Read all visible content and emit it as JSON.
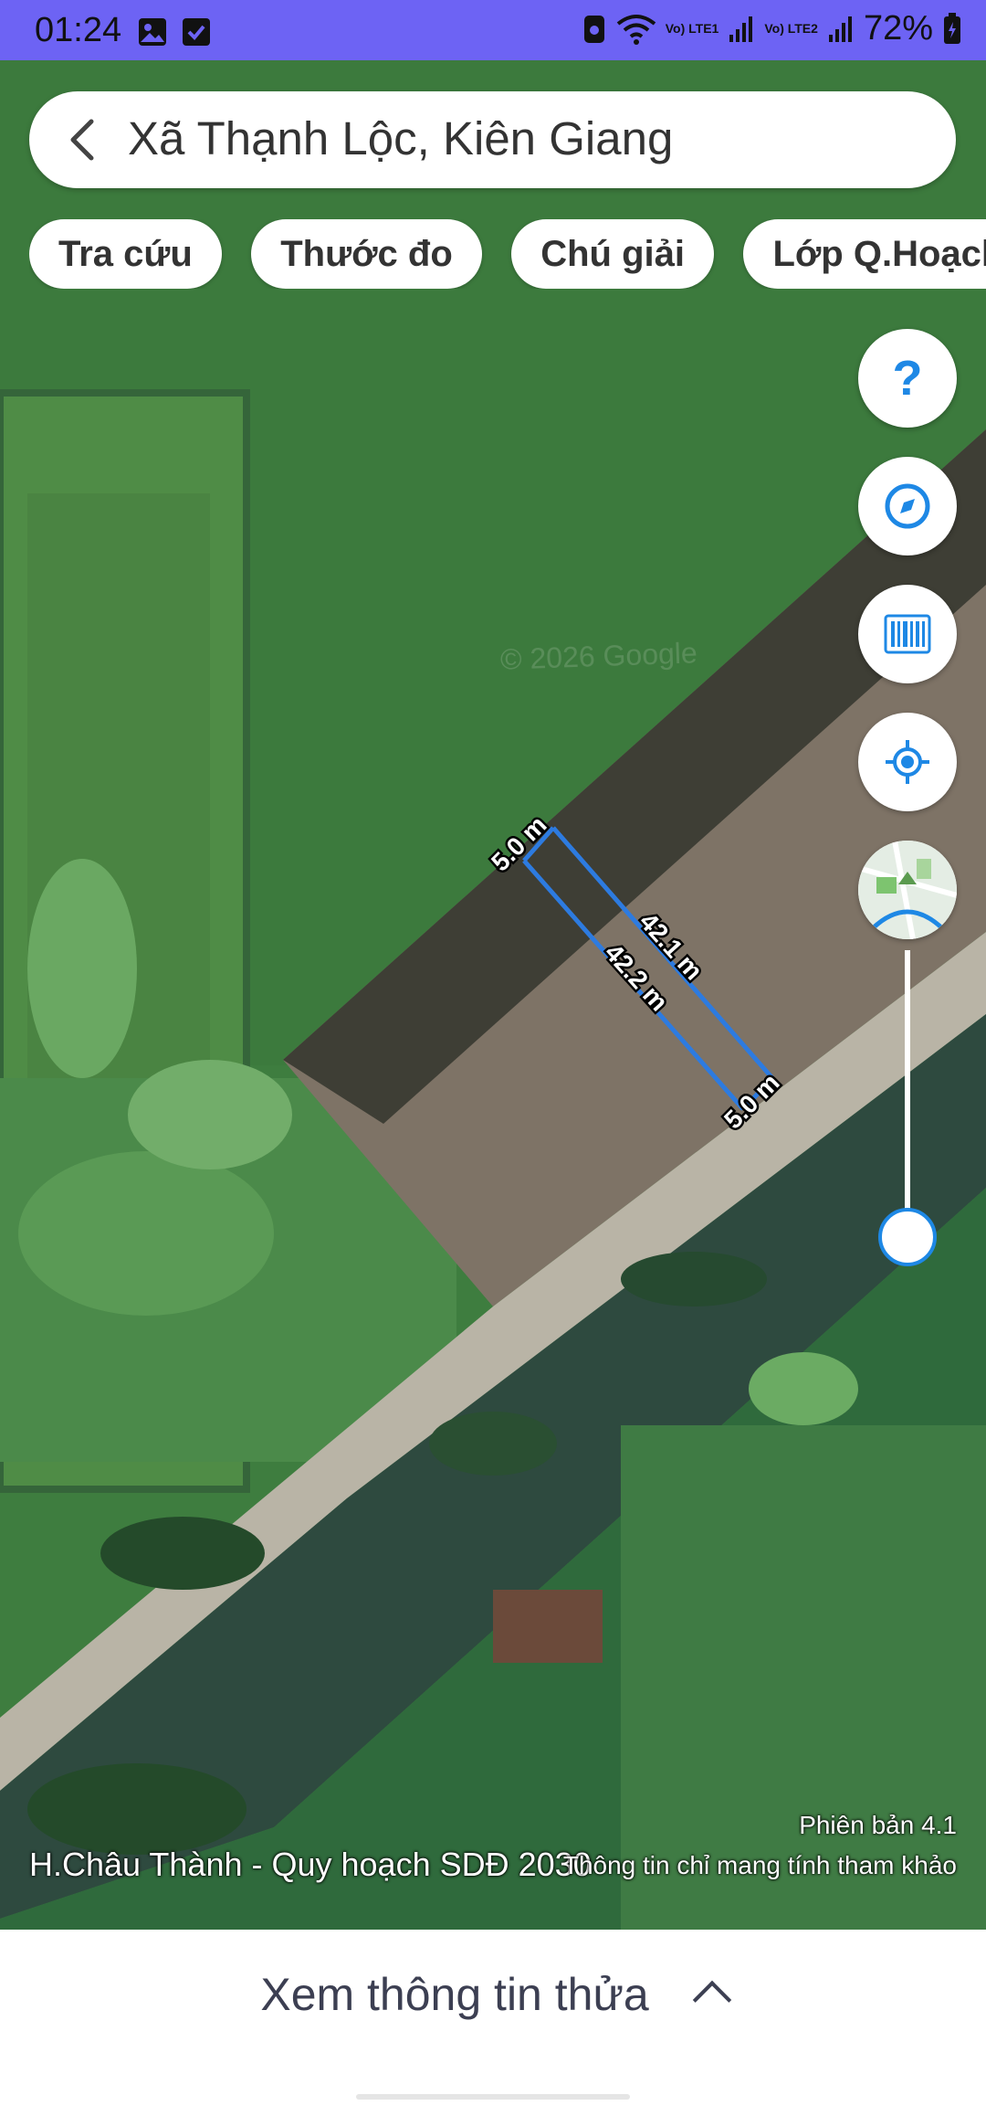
{
  "status_bar": {
    "time": "01:24",
    "network_1": "Vo) LTE1",
    "network_2": "Vo) LTE2",
    "battery_percent": "72%",
    "battery_level": 0.72
  },
  "search": {
    "location": "Xã Thạnh Lộc, Kiên Giang"
  },
  "chips": [
    {
      "label": "Tra cứu"
    },
    {
      "label": "Thước đo"
    },
    {
      "label": "Chú giải"
    },
    {
      "label": "Lớp Q.Hoạch"
    }
  ],
  "fab": {
    "help": "?"
  },
  "measurements": {
    "top_side": "5.0 m",
    "right_long": "42.1 m",
    "left_long": "42.2 m",
    "bottom_side": "5.0 m"
  },
  "map": {
    "watermark": "© 2026 Google",
    "plan_name": "H.Châu Thành - Quy hoạch SDĐ 2030",
    "version": "Phiên bản 4.1",
    "disclaimer": "Thông tin chỉ mang tính tham khảo"
  },
  "bottom": {
    "label": "Xem thông tin thửa"
  },
  "colors": {
    "status_bar": "#6d63f4",
    "accent": "#1e88e5",
    "measure_line": "#2d7be0"
  }
}
